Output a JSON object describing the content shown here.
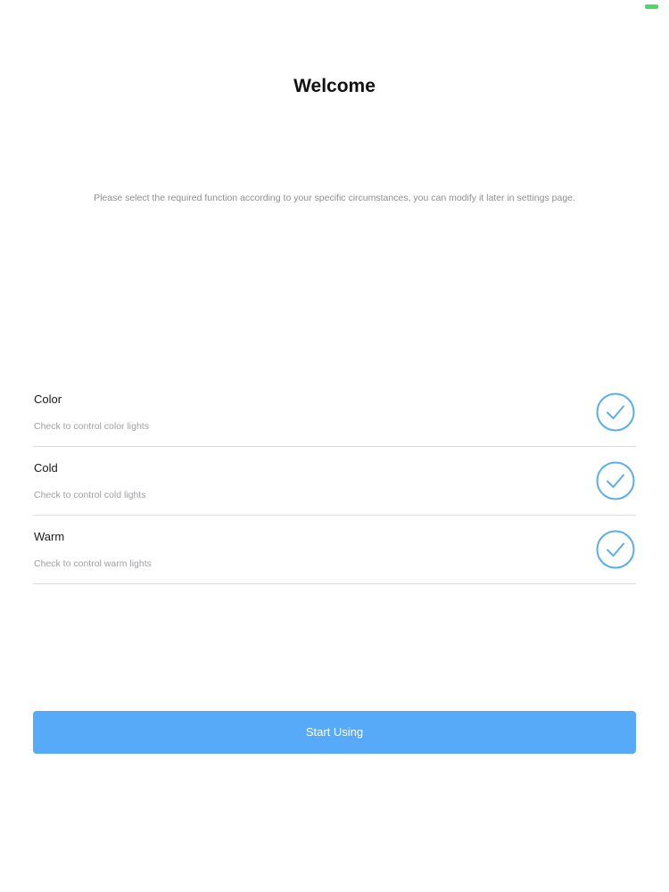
{
  "header": {
    "title": "Welcome",
    "subtitle": "Please select the required function according to your specific circumstances, you can modify it later in settings page."
  },
  "options": [
    {
      "name": "Color",
      "description": "Check to control color lights",
      "checked": true,
      "icon": "checkmark-circle-icon"
    },
    {
      "name": "Cold",
      "description": "Check to control cold lights",
      "checked": true,
      "icon": "checkmark-circle-icon"
    },
    {
      "name": "Warm",
      "description": "Check to control warm lights",
      "checked": true,
      "icon": "checkmark-circle-icon"
    }
  ],
  "actions": {
    "start_label": "Start Using"
  },
  "colors": {
    "accent": "#56aaf7",
    "check": "#5aaef0",
    "status_battery": "#4cd964"
  }
}
